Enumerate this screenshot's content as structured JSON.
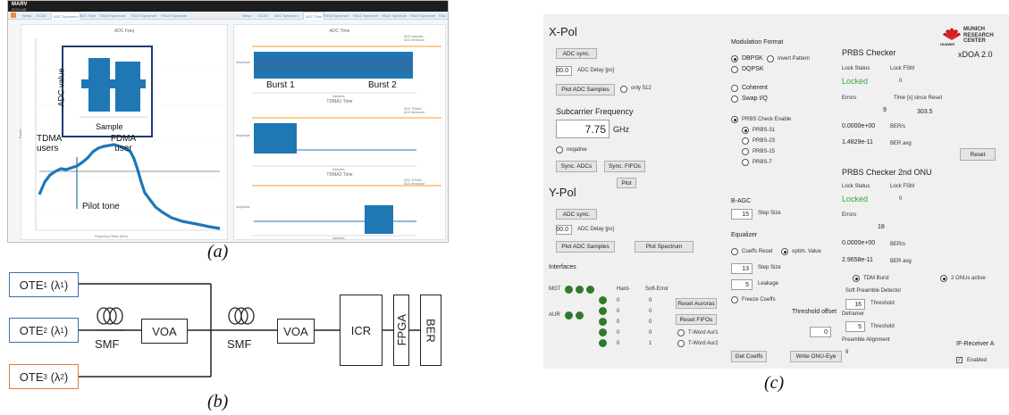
{
  "captions": {
    "a": "(a)",
    "b": "(b)",
    "c": "(c)"
  },
  "panel_a": {
    "app_name": "MARV",
    "app_sub": "ROSLAB",
    "tabs_left": [
      "Setup",
      "ECAS",
      "ADC Spectrum",
      "ADC Time",
      "TDMA Spectrum",
      "FAU1 Spectrum",
      "FAU2 Spectrum"
    ],
    "tabs_right": [
      "Setup",
      "ECAS",
      "ADC Spectrum",
      "ADC Time",
      "TDMA Spectrum",
      "FAU1 Spectrum",
      "FAU2 Spectrum",
      "FAU3 Spectrum",
      "FAU"
    ],
    "freq_plot_title": "ADC Freq",
    "freq_ylabel": "Power",
    "freq_xlabel": "Frequency Offset [GHz]",
    "inset_ylabel": "ADC value",
    "inset_xlabel": "Sample",
    "label_tdma": "TDMA users",
    "label_fdma": "FDMA user",
    "label_pilot": "Pilot tone",
    "time_plot1_title": "ADC Time",
    "time_plot2_title": "TDMA1 Time",
    "time_plot3_title": "TDMA2 Time",
    "burst1": "Burst 1",
    "burst2": "Burst 2",
    "legend1": [
      "ADC samples",
      "ADC threshold"
    ],
    "legend2": [
      "ADC TDMA1",
      "ADC threshold"
    ],
    "legend3": [
      "ADC TDMA2",
      "ADC threshold"
    ],
    "amp_label": "Amplitude",
    "samples_label": "Samples",
    "colors": {
      "trace": "#1f77b4",
      "threshold": "#ff9a2e",
      "inset_frame": "#1e3a73"
    }
  },
  "panel_b": {
    "ote1": "OTE",
    "ote1_sub": "1",
    "ote1_lambda": "(λ",
    "ote1_lsub": "1",
    "ote2": "OTE",
    "ote2_sub": "2",
    "ote2_lambda": "(λ",
    "ote2_lsub": "1",
    "ote3": "OTE",
    "ote3_sub": "3",
    "ote3_lambda": "(λ",
    "ote3_lsub": "2",
    "smf1": "SMF",
    "voa1": "VOA",
    "smf2": "SMF",
    "voa2": "VOA",
    "icr": "ICR",
    "fpga": "FPGA",
    "ber": "BER",
    "colors": {
      "blue": "#3a6fb0",
      "orange": "#e07b3a"
    }
  },
  "panel_c": {
    "xpol": {
      "title": "X-Pol",
      "adc_sync": "ADC sync.",
      "delay_value": "00.0",
      "delay_label": "ADC Delay [ps]",
      "plot_samples": "Plot ADC Samples",
      "only512": "only 512",
      "subcarrier_label": "Subcarrier Frequency",
      "subcarrier_value": "7.75",
      "subcarrier_unit": "GHz",
      "negative": "negative",
      "sync_adcs": "Sync. ADCs",
      "sync_fifos": "Sync. FIFOs",
      "plot": "Plot"
    },
    "ypol": {
      "title": "Y-Pol",
      "adc_sync": "ADC sync.",
      "delay_value": "00.0",
      "delay_label": "ADC Delay [ps]",
      "plot_samples": "Plot ADC Samples",
      "plot_spectrum": "Plot Spectrum"
    },
    "interfaces": {
      "title": "Interfaces",
      "mgt": "MGT",
      "aur": "AUR",
      "hard_label": "Hard-",
      "soft_label": "Soft-Error",
      "hard_values": [
        "0",
        "0",
        "0",
        "0",
        "0"
      ],
      "soft_values": [
        "0",
        "0",
        "0",
        "0",
        "1"
      ],
      "reset_aurora": "Reset Auroras",
      "reset_fifos": "Reset FIFOs",
      "tword1": "T-Word Aur1",
      "tword2": "T-Word Aur2"
    },
    "modulation": {
      "title": "Modulation Format",
      "dbpsk": "DBPSK",
      "invert": "Invert Pattern",
      "dqpsk": "DQPSK",
      "coherent": "Coherent",
      "swap": "Swap I/Q",
      "prbs_enable": "PRBS Check Enable",
      "prbs31": "PRBS-31",
      "prbs23": "PRBS-23",
      "prbs15": "PRBS-15",
      "prbs7": "PRBS-7"
    },
    "bagc": {
      "title": "B-AGC",
      "value": "15",
      "label": "Step Size"
    },
    "equalizer": {
      "title": "Equalizer",
      "coeffs_reset": "Coeffs Reset",
      "optim": "optim. Value",
      "step_value": "13",
      "step_label": "Step Size",
      "leak_value": "5",
      "leak_label": "Leakage",
      "freeze": "Freeze Coeffs"
    },
    "threshold": {
      "label": "Threshold offset",
      "value": "0"
    },
    "buttons": {
      "get_coeffs": "Get Coeffs",
      "write_onu": "Write ONU-Eye"
    },
    "prbs1": {
      "title": "PRBS Checker",
      "lock_status": "Lock Status",
      "lock_fsm": "Lock FSM",
      "locked": "Locked",
      "fsm_value": "0",
      "errors_label": "Errors",
      "time_label": "Time [s] since Reset",
      "errors_value": "9",
      "time_value": "303.5",
      "ber_s_value": "0.0000e+00",
      "ber_s_label": "BER/s",
      "ber_avg_value": "1.4829e-11",
      "ber_avg_label": "BER avg",
      "reset": "Reset"
    },
    "prbs2": {
      "title": "PRBS Checker 2nd ONU",
      "lock_status": "Lock Status",
      "lock_fsm": "Lock FSM",
      "locked": "Locked",
      "fsm_value": "0",
      "errors_label": "Errors",
      "errors_value": "18",
      "ber_s_value": "0.0000e+00",
      "ber_s_label": "BER/s",
      "ber_avg_value": "2.9658e-11",
      "ber_avg_label": "BER avg"
    },
    "tdm": {
      "burst": "TDM Burst",
      "onus": "2 ONUs active",
      "soft_preamble": "Soft Preamble Detector",
      "threshold_value": "16",
      "threshold_label": "Threshold",
      "deframer": "Deframer",
      "deframer_value": "5",
      "deframer_label": "Threshold",
      "preamble_label": "Preamble Alignment",
      "preamble_value": "9"
    },
    "ifreceiver": {
      "title": "IF-Receiver A",
      "enabled": "Enabled"
    },
    "brand": {
      "name": "HUAWEI",
      "center": [
        "MUNICH",
        "RESEARCH",
        "CENTER"
      ],
      "product": "xDOA 2.0"
    }
  }
}
